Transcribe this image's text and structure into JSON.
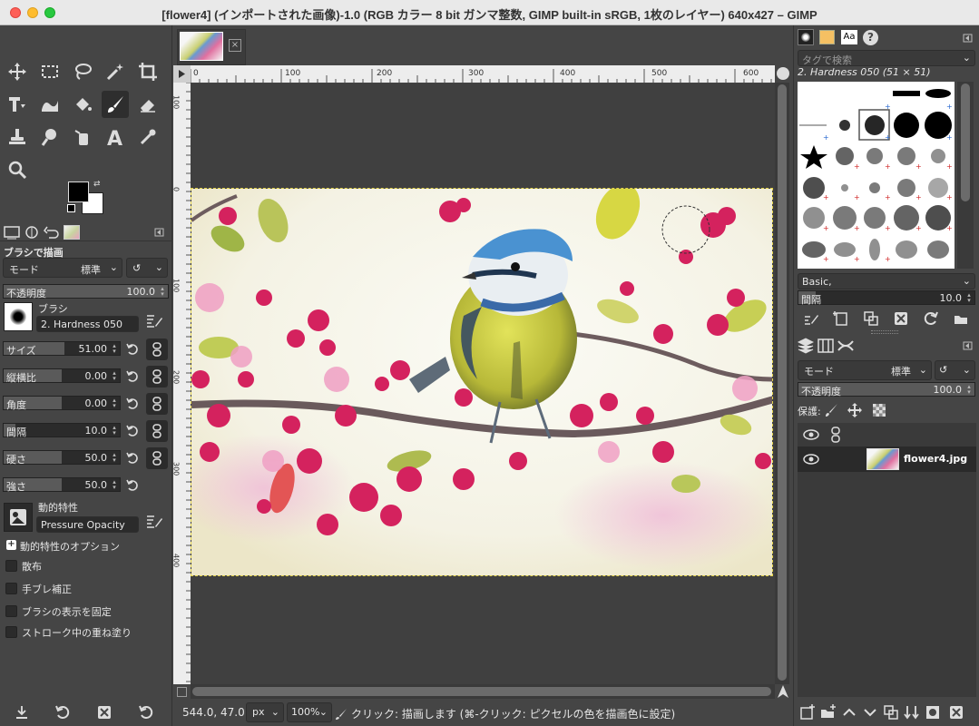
{
  "window": {
    "title": "[flower4] (インポートされた画像)-1.0 (RGB カラー 8 bit ガンマ整数, GIMP built-in sRGB, 1枚のレイヤー) 640x427 – GIMP"
  },
  "tool_options": {
    "title": "ブラシで描画",
    "mode_label": "モード",
    "mode_value": "標準",
    "opacity_label": "不透明度",
    "opacity_value": "100.0",
    "brush_label": "ブラシ",
    "brush_name": "2. Hardness 050",
    "size_label": "サイズ",
    "size_value": "51.00",
    "size_fraction": 0.52,
    "aspect_label": "縦横比",
    "aspect_value": "0.00",
    "aspect_fraction": 0.5,
    "angle_label": "角度",
    "angle_value": "0.00",
    "angle_fraction": 0.5,
    "spacing_label": "間隔",
    "spacing_value": "10.0",
    "spacing_fraction": 0.1,
    "hardness_label": "硬さ",
    "hardness_value": "50.0",
    "hardness_fraction": 0.5,
    "force_label": "強さ",
    "force_value": "50.0",
    "force_fraction": 0.5,
    "dynamics_label": "動的特性",
    "dynamics_name": "Pressure Opacity",
    "dynamics_options": "動的特性のオプション",
    "scatter": "散布",
    "smooth": "手ブレ補正",
    "lock_brush": "ブラシの表示を固定",
    "incremental": "ストローク中の重ね塗り"
  },
  "canvas": {
    "ruler_ticks": [
      "0",
      "100",
      "200",
      "300",
      "400",
      "500",
      "600"
    ],
    "ruler_v_ticks": [
      "100",
      "0",
      "100",
      "200",
      "300",
      "400"
    ]
  },
  "status": {
    "coords": "544.0, 47.0",
    "unit": "px",
    "zoom": "100%",
    "message": "クリック: 描画します (⌘-クリック: ピクセルの色を描画色に設定)"
  },
  "brushes": {
    "search_placeholder": "タグで検索",
    "selected": "2. Hardness 050 (51 × 51)",
    "set_name": "Basic,",
    "spacing_label": "間隔",
    "spacing_value": "10.0"
  },
  "layers": {
    "mode_label": "モード",
    "mode_value": "標準",
    "opacity_label": "不透明度",
    "opacity_value": "100.0",
    "lock_label": "保護:",
    "layer_name": "flower4.jpg"
  },
  "colors": {
    "fg": "#000000",
    "bg": "#ffffff",
    "selection": "#e3d34a"
  }
}
